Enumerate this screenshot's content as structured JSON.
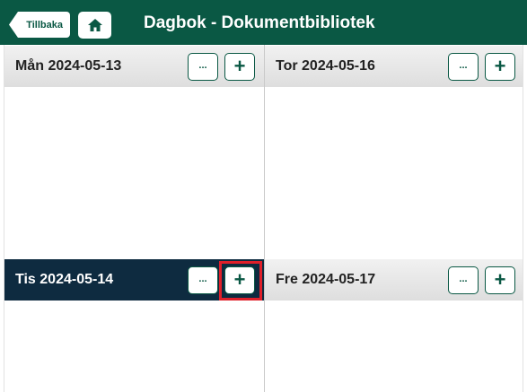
{
  "header": {
    "back_label": "Tillbaka",
    "title": "Dagbok - Dokumentbibliotek",
    "home_icon": "home-icon",
    "bg_color": "#0a5844"
  },
  "days": [
    {
      "title": "Mån 2024-05-13",
      "more_label": "...",
      "add_label": "+",
      "active": false
    },
    {
      "title": "Tor 2024-05-16",
      "more_label": "...",
      "add_label": "+",
      "active": false
    },
    {
      "title": "Tis 2024-05-14",
      "more_label": "...",
      "add_label": "+",
      "active": true
    },
    {
      "title": "Fre 2024-05-17",
      "more_label": "...",
      "add_label": "+",
      "active": false
    }
  ],
  "colors": {
    "accent": "#0a5844",
    "active_header": "#0e2b40",
    "highlight": "#e0202a"
  }
}
